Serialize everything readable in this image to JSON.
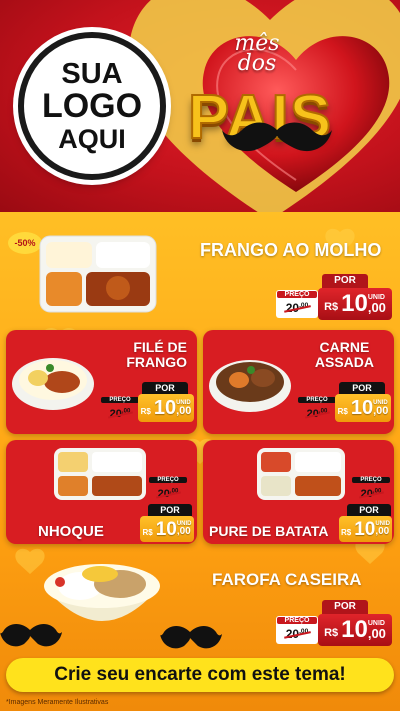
{
  "header": {
    "logo": {
      "line1": "SUA",
      "line2": "LOGO",
      "line3": "AQUI"
    },
    "campaign": {
      "small": "mês dos",
      "big": "PAIS"
    }
  },
  "products": [
    {
      "name": "FRANGO AO MOLHO",
      "badge": "-50%",
      "preco_label": "PREÇO",
      "por_label": "POR",
      "old_int": "20",
      "old_frac": ",00",
      "currency": "R$",
      "new_int": "10",
      "new_frac": ",00",
      "unit": "UNID"
    },
    {
      "name_l1": "FILÉ DE",
      "name_l2": "FRANGO",
      "preco_label": "PREÇO",
      "por_label": "POR",
      "old_int": "20",
      "old_frac": ",00",
      "currency": "R$",
      "new_int": "10",
      "new_frac": ",00",
      "unit": "UNID"
    },
    {
      "name_l1": "CARNE",
      "name_l2": "ASSADA",
      "preco_label": "PREÇO",
      "por_label": "POR",
      "old_int": "20",
      "old_frac": ",00",
      "currency": "R$",
      "new_int": "10",
      "new_frac": ",00",
      "unit": "UNID"
    },
    {
      "name": "NHOQUE",
      "preco_label": "PREÇO",
      "por_label": "POR",
      "old_int": "20",
      "old_frac": ",00",
      "currency": "R$",
      "new_int": "10",
      "new_frac": ",00",
      "unit": "UNID"
    },
    {
      "name": "PURE DE BATATA",
      "preco_label": "PREÇO",
      "por_label": "POR",
      "old_int": "20",
      "old_frac": ",00",
      "currency": "R$",
      "new_int": "10",
      "new_frac": ",00",
      "unit": "UNID"
    },
    {
      "name": "FAROFA CASEIRA",
      "preco_label": "PREÇO",
      "por_label": "POR",
      "old_int": "20",
      "old_frac": ",00",
      "currency": "R$",
      "new_int": "10",
      "new_frac": ",00",
      "unit": "UNID"
    }
  ],
  "footer": {
    "cta": "Crie seu encarte com este tema!",
    "disclaimer": "*Imagens Meramente Ilustrativas"
  },
  "colors": {
    "red": "#d81d22",
    "yellow": "#ffe21c",
    "orange": "#ffb31f",
    "gold": "#f7c21b"
  },
  "icons": [
    "heart-icon",
    "mustache-icon"
  ]
}
